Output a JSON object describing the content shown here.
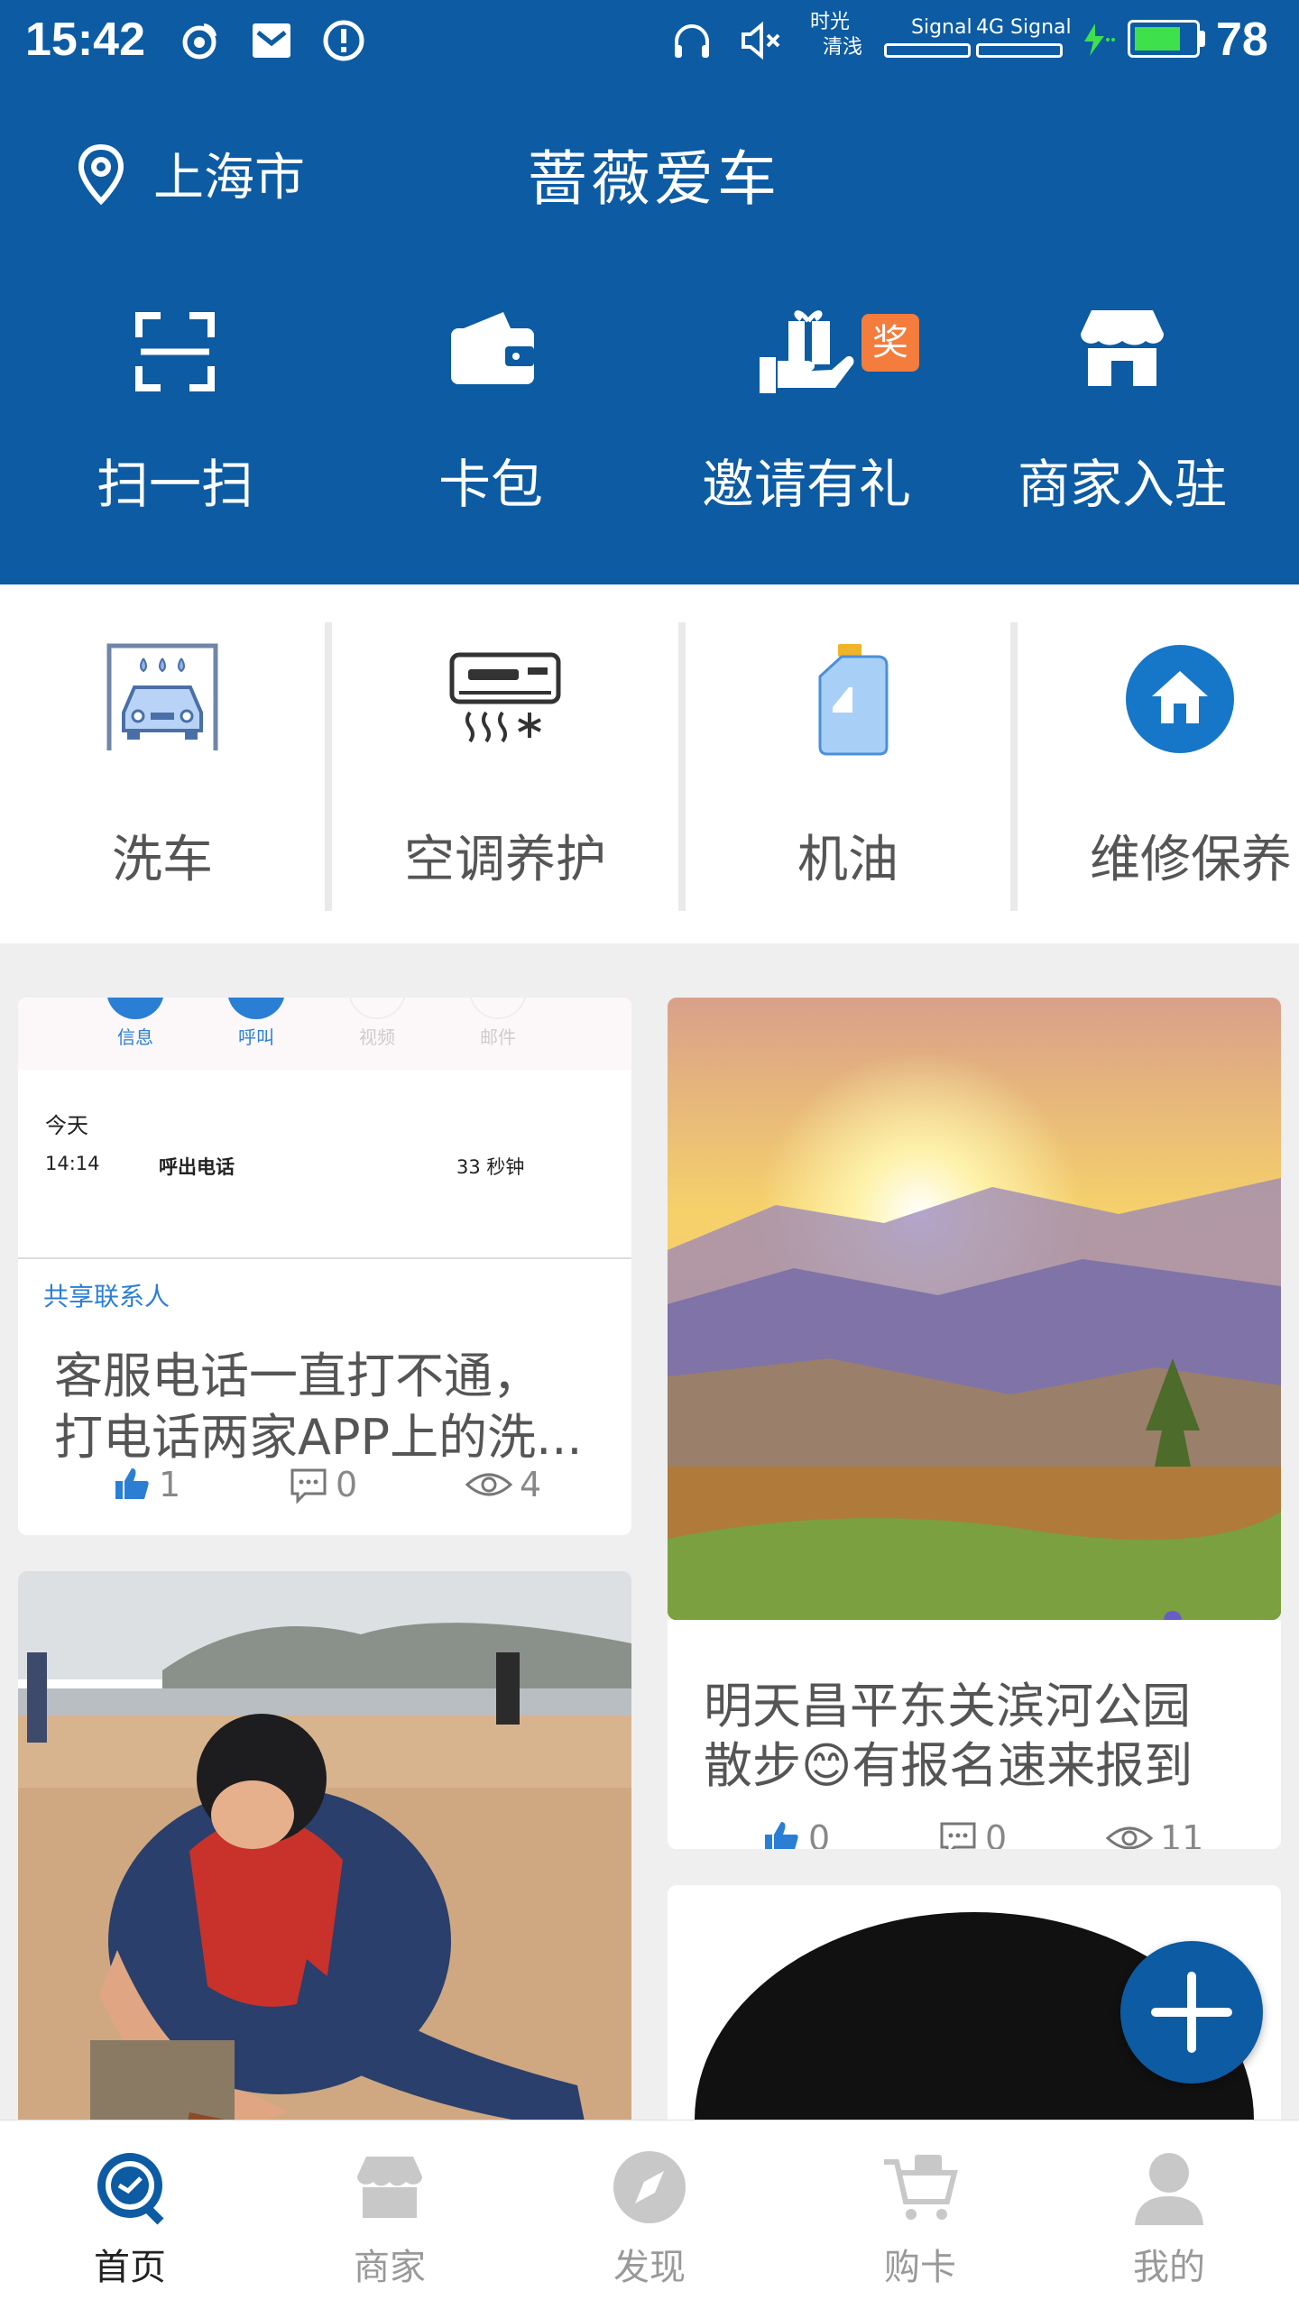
{
  "status_bar": {
    "time": "15:42",
    "carrier_line1": "时光",
    "carrier_line2": "清浅",
    "signal1_label": "Signal",
    "signal2_label": "4G Signal",
    "battery_level": "78",
    "battery_fraction": 0.78,
    "icons": [
      "weibo-icon",
      "mail-icon",
      "alert-icon",
      "headphones-icon",
      "mute-icon",
      "charging-icon"
    ]
  },
  "header": {
    "city": "上海市",
    "app_title": "蔷薇爱车",
    "quick_actions": [
      {
        "label": "扫一扫",
        "icon": "scan-icon"
      },
      {
        "label": "卡包",
        "icon": "wallet-icon"
      },
      {
        "label": "邀请有礼",
        "icon": "gift-hand-icon",
        "badge": "奖"
      },
      {
        "label": "商家入驻",
        "icon": "store-icon"
      }
    ]
  },
  "services": [
    {
      "label": "洗车",
      "icon": "car-wash-icon"
    },
    {
      "label": "空调养护",
      "icon": "air-conditioner-icon"
    },
    {
      "label": "机油",
      "icon": "engine-oil-icon"
    },
    {
      "label": "维修保养",
      "icon": "repair-home-icon"
    }
  ],
  "feed": {
    "card1": {
      "screenshot": {
        "actions": [
          "信息",
          "呼叫",
          "视频",
          "邮件"
        ],
        "day": "今天",
        "call_time": "14:14",
        "call_type": "呼出电话",
        "duration": "33 秒钟",
        "share": "共享联系人"
      },
      "title_line1": "客服电话一直打不通，",
      "title_line2": "打电话两家APP上的洗...",
      "likes": "1",
      "comments": "0",
      "views": "4"
    },
    "card2": {
      "title_line1": "明天昌平东关滨河公园",
      "title_line2a": "散步",
      "emoji": "😊",
      "title_line2b": "有报名速来报到",
      "likes": "0",
      "comments": "0",
      "views": "11"
    }
  },
  "bottom_nav": [
    {
      "label": "首页",
      "icon": "home-logo-icon",
      "active": true
    },
    {
      "label": "商家",
      "icon": "shop-icon",
      "active": false
    },
    {
      "label": "发现",
      "icon": "compass-icon",
      "active": false
    },
    {
      "label": "购卡",
      "icon": "cart-icon",
      "active": false
    },
    {
      "label": "我的",
      "icon": "user-icon",
      "active": false
    }
  ],
  "colors": {
    "brand_blue": "#0c5ba3",
    "badge_orange": "#f47c3c",
    "link_blue": "#2a7fd4",
    "battery_green": "#3ee04b"
  }
}
